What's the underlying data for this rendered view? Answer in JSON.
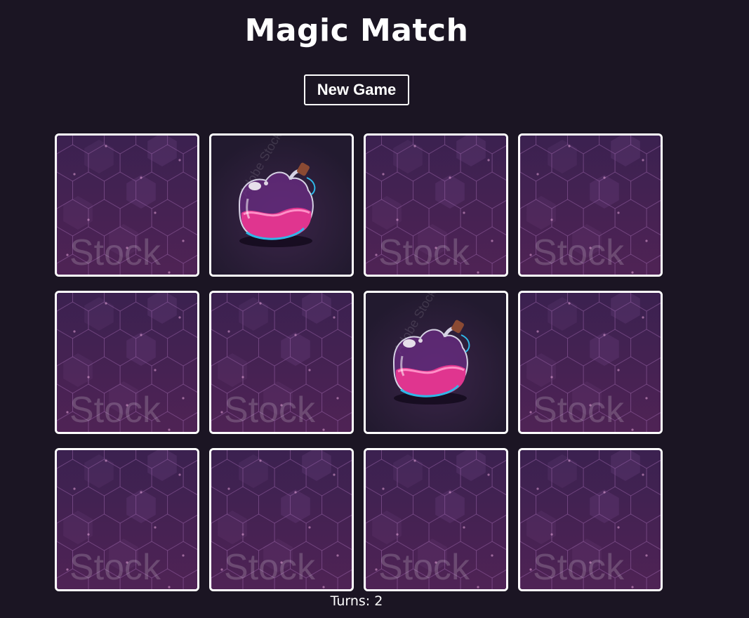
{
  "title": "Magic Match",
  "new_game_label": "New Game",
  "turns_label": "Turns:",
  "turns": "2",
  "card_back_watermark": "Stock",
  "potion_watermark": "Adobe Stock",
  "colors": {
    "background": "#1b1523",
    "card_back_base": "#4f2355",
    "card_back_top": "#3b2150",
    "potion_bg": "#221a2f",
    "potion_liquid": "#e0358f",
    "potion_glass": "#6b2c84",
    "potion_rim": "#2fb8e8",
    "cork": "#8b4a33"
  },
  "cards": [
    {
      "face": "back"
    },
    {
      "face": "potion"
    },
    {
      "face": "back"
    },
    {
      "face": "back"
    },
    {
      "face": "back"
    },
    {
      "face": "back"
    },
    {
      "face": "potion"
    },
    {
      "face": "back"
    },
    {
      "face": "back"
    },
    {
      "face": "back"
    },
    {
      "face": "back"
    },
    {
      "face": "back"
    }
  ]
}
